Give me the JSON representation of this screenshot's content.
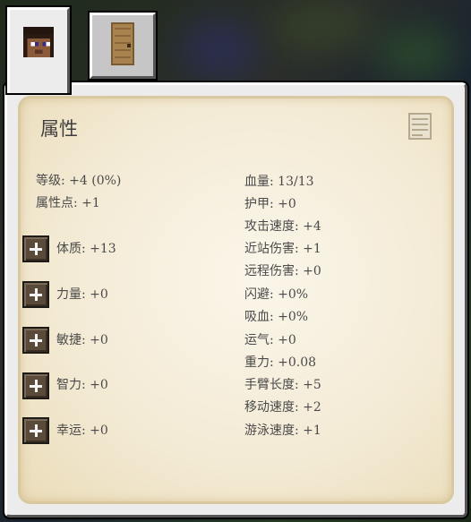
{
  "tabs": [
    {
      "icon": "player-head-icon",
      "active": true
    },
    {
      "icon": "door-icon",
      "active": false
    }
  ],
  "panel": {
    "title": "属性",
    "scroll_icon": "scroll-icon"
  },
  "left": {
    "level": "等级: +4 (0%)",
    "points": "属性点: +1",
    "attributes": [
      {
        "label": "体质: +13"
      },
      {
        "label": "力量: +0"
      },
      {
        "label": "敏捷: +0"
      },
      {
        "label": "智力: +0"
      },
      {
        "label": "幸运: +0"
      }
    ]
  },
  "right": {
    "stats": [
      "血量: 13/13",
      "护甲: +0",
      "攻击速度: +4",
      "近站伤害: +1",
      "远程伤害: +0",
      "闪避: +0%",
      "吸血: +0%",
      "运气: +0",
      "重力: +0.08",
      "手臂长度: +5",
      "移动速度: +2",
      "游泳速度: +1"
    ]
  },
  "colors": {
    "parchment": "#f3ead4",
    "text": "#4a4a4a",
    "button": "#5a4a3a"
  }
}
